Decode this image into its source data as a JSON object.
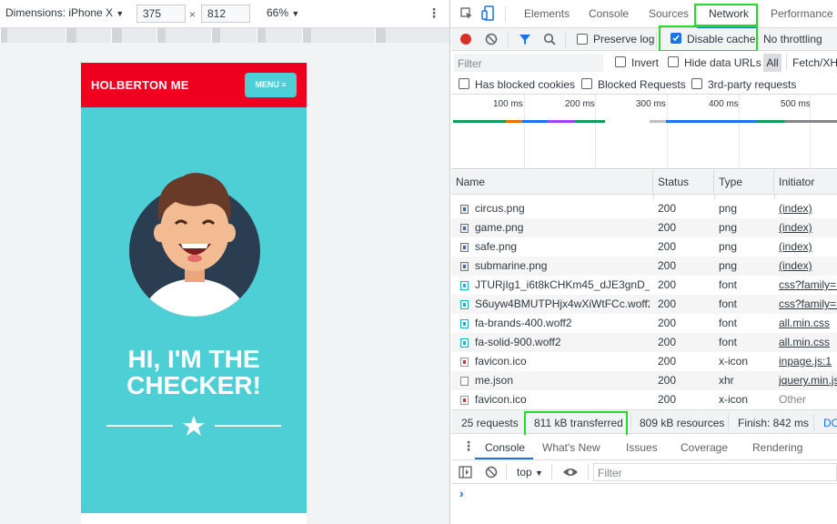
{
  "device_toolbar": {
    "dimensions_label": "Dimensions: iPhone X",
    "width": "375",
    "times": "×",
    "height": "812",
    "zoom": "66%"
  },
  "site": {
    "brand": "HOLBERTON ME",
    "menu_label": "MENU ≡",
    "hero_line1": "HI, I'M THE",
    "hero_line2": "CHECKER!"
  },
  "devtools": {
    "tabs": [
      "Elements",
      "Console",
      "Sources",
      "Network",
      "Performance"
    ],
    "active_tab": "Network",
    "network_toolbar": {
      "preserve_log": "Preserve log",
      "disable_cache": "Disable cache",
      "throttling": "No throttling"
    },
    "filter_row": {
      "filter_placeholder": "Filter",
      "invert": "Invert",
      "hide_data_urls": "Hide data URLs",
      "all": "All",
      "fetch_xhr": "Fetch/XH"
    },
    "filter_row2": {
      "blocked_cookies": "Has blocked cookies",
      "blocked_requests": "Blocked Requests",
      "third_party": "3rd-party requests"
    },
    "timeline_ticks": [
      "100 ms",
      "200 ms",
      "300 ms",
      "400 ms",
      "500 ms"
    ],
    "table": {
      "columns": [
        "Name",
        "Status",
        "Type",
        "Initiator"
      ],
      "rows": [
        {
          "name": "circus.png",
          "status": "200",
          "type": "png",
          "initiator": "(index)"
        },
        {
          "name": "game.png",
          "status": "200",
          "type": "png",
          "initiator": "(index)"
        },
        {
          "name": "safe.png",
          "status": "200",
          "type": "png",
          "initiator": "(index)"
        },
        {
          "name": "submarine.png",
          "status": "200",
          "type": "png",
          "initiator": "(index)"
        },
        {
          "name": "JTURjIg1_i6t8kCHKm45_dJE3gnD_...",
          "status": "200",
          "type": "font",
          "initiator": "css?family=M"
        },
        {
          "name": "S6uyw4BMUTPHjx4wXiWtFCc.woff2",
          "status": "200",
          "type": "font",
          "initiator": "css?family=M"
        },
        {
          "name": "fa-brands-400.woff2",
          "status": "200",
          "type": "font",
          "initiator": "all.min.css"
        },
        {
          "name": "fa-solid-900.woff2",
          "status": "200",
          "type": "font",
          "initiator": "all.min.css"
        },
        {
          "name": "favicon.ico",
          "status": "200",
          "type": "x-icon",
          "initiator": "inpage.js:1"
        },
        {
          "name": "me.json",
          "status": "200",
          "type": "xhr",
          "initiator": "jquery.min.js"
        },
        {
          "name": "favicon.ico",
          "status": "200",
          "type": "x-icon",
          "initiator": "Other"
        }
      ]
    },
    "status_bar": {
      "requests": "25 requests",
      "transferred": "811 kB transferred",
      "resources": "809 kB resources",
      "finish": "Finish: 842 ms",
      "dom": "DO"
    },
    "drawer_tabs": [
      "Console",
      "What's New",
      "Issues",
      "Coverage",
      "Rendering"
    ],
    "console": {
      "context": "top",
      "filter_placeholder": "Filter",
      "prompt": "›"
    }
  },
  "colors": {
    "brand_red": "#f0001e",
    "brand_teal": "#4ecfd6",
    "highlight_green": "#22dd22",
    "accent_blue": "#1a73e8"
  }
}
